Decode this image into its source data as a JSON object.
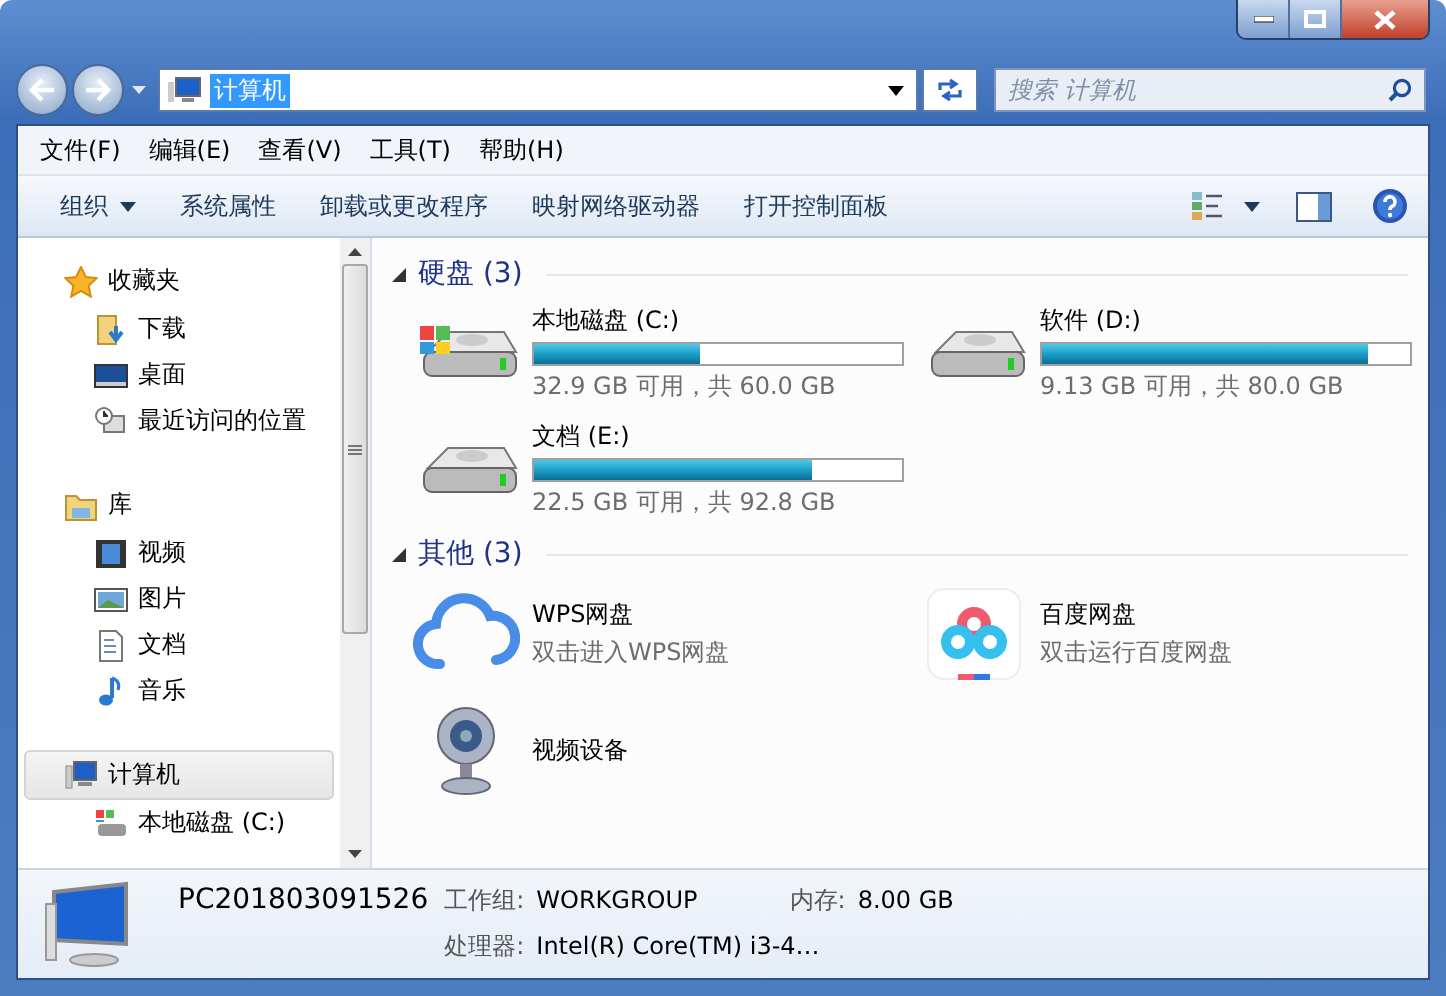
{
  "address_bar": {
    "value": "计算机"
  },
  "search": {
    "placeholder": "搜索 计算机"
  },
  "menu": [
    "文件(F)",
    "编辑(E)",
    "查看(V)",
    "工具(T)",
    "帮助(H)"
  ],
  "toolbar": [
    {
      "label": "组织",
      "dropdown": true
    },
    {
      "label": "系统属性",
      "dropdown": false
    },
    {
      "label": "卸载或更改程序",
      "dropdown": false
    },
    {
      "label": "映射网络驱动器",
      "dropdown": false
    },
    {
      "label": "打开控制面板",
      "dropdown": false
    }
  ],
  "sidebar": [
    {
      "label": "收藏夹",
      "kind": "star",
      "selected": false,
      "children": [
        {
          "label": "下载",
          "kind": "download"
        },
        {
          "label": "桌面",
          "kind": "desktop"
        },
        {
          "label": "最近访问的位置",
          "kind": "recent"
        }
      ]
    },
    {
      "label": "库",
      "kind": "library",
      "selected": false,
      "children": [
        {
          "label": "视频",
          "kind": "video"
        },
        {
          "label": "图片",
          "kind": "picture"
        },
        {
          "label": "文档",
          "kind": "document"
        },
        {
          "label": "音乐",
          "kind": "music"
        }
      ]
    },
    {
      "label": "计算机",
      "kind": "computer",
      "selected": true,
      "children": [
        {
          "label": "本地磁盘 (C:)",
          "kind": "system-drive"
        }
      ]
    }
  ],
  "sections": [
    {
      "title": "硬盘 (3)",
      "expanded": true,
      "items": [
        {
          "kind": "system-drive",
          "name": "本地磁盘 (C:)",
          "level": 0.45,
          "detail": "32.9 GB 可用，共 60.0 GB"
        },
        {
          "kind": "drive",
          "name": "软件 (D:)",
          "level": 0.886,
          "detail": "9.13 GB 可用，共 80.0 GB"
        },
        {
          "kind": "drive",
          "name": "文档 (E:)",
          "level": 0.757,
          "detail": "22.5 GB 可用，共 92.8 GB"
        }
      ]
    },
    {
      "title": "其他 (3)",
      "expanded": true,
      "items": [
        {
          "kind": "wps",
          "name": "WPS网盘",
          "detail": "双击进入WPS网盘"
        },
        {
          "kind": "baidu",
          "name": "百度网盘",
          "detail": "双击运行百度网盘"
        },
        {
          "kind": "webcam",
          "name": "视频设备"
        }
      ]
    }
  ],
  "details": {
    "name": "PC201803091526",
    "workgroup_label": "工作组:",
    "workgroup": "WORKGROUP",
    "memory_label": "内存:",
    "memory": "8.00 GB",
    "cpu_label": "处理器:",
    "cpu": "Intel(R) Core(TM) i3-4…"
  }
}
